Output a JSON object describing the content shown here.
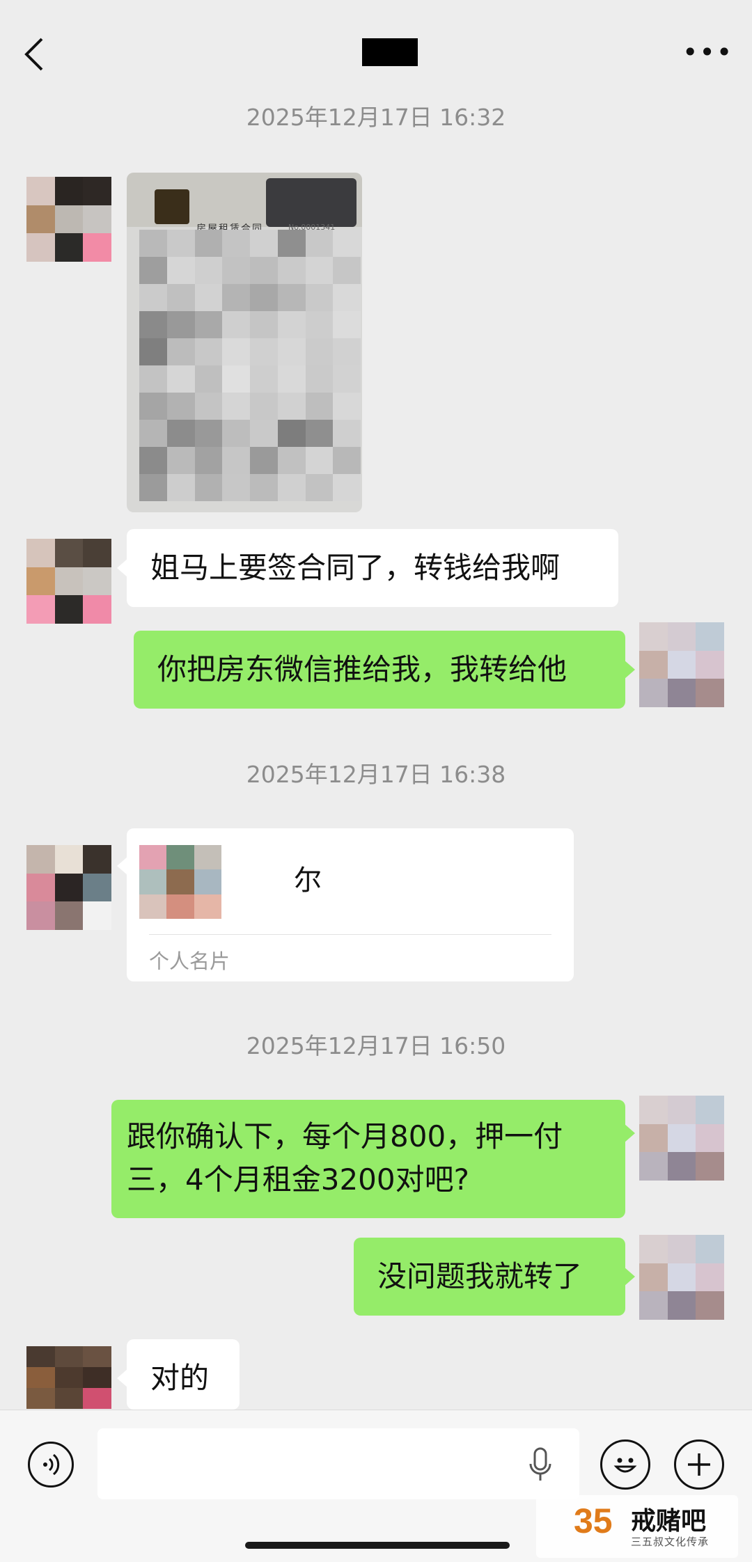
{
  "header": {
    "back_label": "<",
    "more_label": "•••"
  },
  "timestamps": [
    "2025年12月17日 16:32",
    "2025年12月17日 16:38",
    "2025年12月17日 16:50"
  ],
  "messages": {
    "m1": "姐马上要签合同了，转钱给我啊",
    "m2": "你把房东微信推给我，我转给他",
    "m3_line1": "跟你确认下，每个月800，押一付",
    "m3_line2": "三，4个月租金3200对吧?",
    "m4": "没问题我就转了",
    "m5": "对的"
  },
  "image_message": {
    "doc_title": "房屋租赁合同",
    "doc_no": "No.0001341"
  },
  "contact_card": {
    "name": "尔",
    "label": "个人名片"
  },
  "watermark": {
    "logo_number": "35",
    "brand": "戒赌吧",
    "tagline": "三五叔文化传承"
  },
  "icons": {
    "back": "chevron-left-icon",
    "more": "more-dots-icon",
    "voice": "voice-icon",
    "mic": "microphone-icon",
    "emoji": "emoji-icon",
    "plus": "plus-icon"
  },
  "colors": {
    "background": "#ededed",
    "outgoing_bubble": "#95ec69",
    "incoming_bubble": "#ffffff",
    "timestamp": "#8c8c8c"
  }
}
